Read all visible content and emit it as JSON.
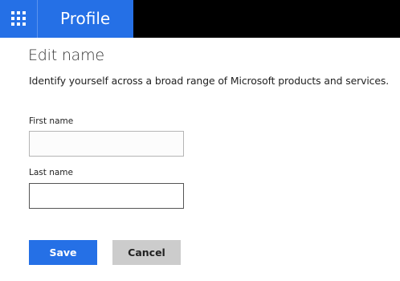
{
  "header": {
    "app_name": "Profile",
    "launcher_icon": "app-launcher-grid-icon",
    "accent_color": "#2570e6",
    "bar_color": "#000000"
  },
  "main": {
    "title": "Edit name",
    "description": "Identify yourself across a broad range of Microsoft products and services.",
    "first_name": {
      "label": "First name",
      "value": ""
    },
    "last_name": {
      "label": "Last name",
      "value": ""
    },
    "actions": {
      "save_label": "Save",
      "cancel_label": "Cancel"
    }
  }
}
